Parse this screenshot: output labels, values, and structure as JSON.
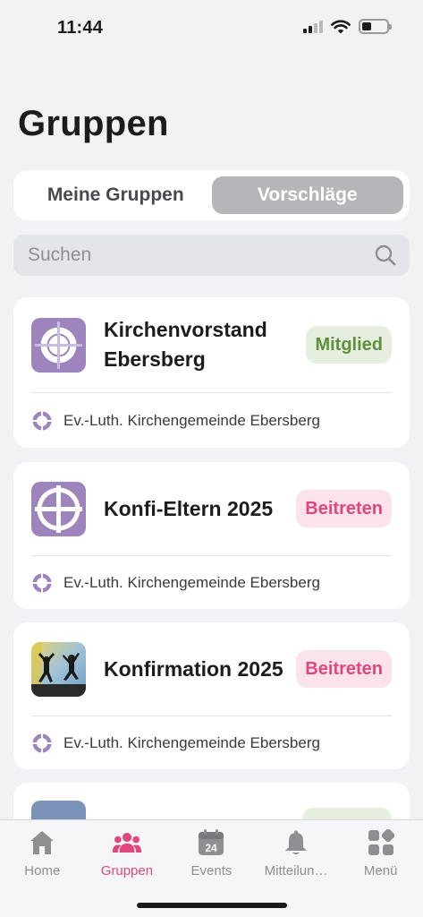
{
  "status_bar": {
    "time": "11:44"
  },
  "page": {
    "title": "Gruppen"
  },
  "segmented": {
    "options": [
      "Meine Gruppen",
      "Vorschläge"
    ],
    "selected": "Vorschläge"
  },
  "search": {
    "placeholder": "Suchen",
    "value": ""
  },
  "groups": [
    {
      "name_lines": [
        "Kirchenvorstand",
        "Ebersberg"
      ],
      "badge": "Mitglied",
      "badge_type": "member",
      "organization": "Ev.-Luth. Kirchengemeinde Ebersberg",
      "image": "church-logo"
    },
    {
      "name_lines": [
        "Konfi-Eltern 2025"
      ],
      "badge": "Beitreten",
      "badge_type": "join",
      "organization": "Ev.-Luth. Kirchengemeinde Ebersberg",
      "image": "church-logo"
    },
    {
      "name_lines": [
        "Konfirmation 2025"
      ],
      "badge": "Beitreten",
      "badge_type": "join",
      "organization": "Ev.-Luth. Kirchengemeinde Ebersberg",
      "image": "jumping-people-photo"
    }
  ],
  "tabs": [
    {
      "label": "Home",
      "icon": "home-icon",
      "active": false
    },
    {
      "label": "Gruppen",
      "icon": "people-icon",
      "active": true
    },
    {
      "label": "Events",
      "icon": "calendar-icon",
      "calendar_day": "24",
      "active": false
    },
    {
      "label": "Mitteilun…",
      "icon": "bell-icon",
      "active": false
    },
    {
      "label": "Menü",
      "icon": "menu-grid-icon",
      "active": false
    }
  ],
  "colors": {
    "accent": "#e0467f",
    "member_green": "#5f8f3a",
    "brand_purple": "#9d84bd",
    "background": "#f2f2f4"
  }
}
